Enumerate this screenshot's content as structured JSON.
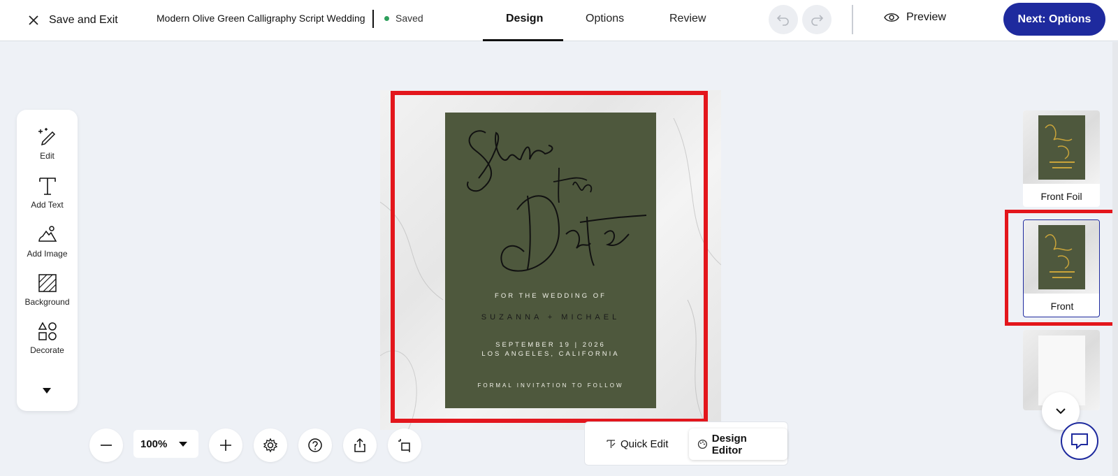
{
  "header": {
    "exit_label": "Save and Exit",
    "doc_title": "Modern Olive Green Calligraphy Script Wedding",
    "save_status": "Saved",
    "tabs": [
      {
        "label": "Design",
        "active": true
      },
      {
        "label": "Options",
        "active": false
      },
      {
        "label": "Review",
        "active": false
      }
    ],
    "preview_label": "Preview",
    "next_label": "Next: Options"
  },
  "tools": [
    {
      "label": "Edit",
      "icon": "magic-pencil-icon"
    },
    {
      "label": "Add Text",
      "icon": "text-icon"
    },
    {
      "label": "Add Image",
      "icon": "image-icon"
    },
    {
      "label": "Background",
      "icon": "background-icon"
    },
    {
      "label": "Decorate",
      "icon": "shapes-icon"
    }
  ],
  "card": {
    "script": "Save the Date",
    "line1": "FOR THE WEDDING OF",
    "names": "SUZANNA + MICHAEL",
    "date": "SEPTEMBER 19 | 2026",
    "location": "LOS ANGELES, CALIFORNIA",
    "footer": "FORMAL INVITATION TO FOLLOW"
  },
  "thumbnails": [
    {
      "label": "Front Foil",
      "selected": false
    },
    {
      "label": "Front",
      "selected": true
    }
  ],
  "zoom": {
    "value": "100%"
  },
  "modes": {
    "quick_edit": "Quick Edit",
    "design_editor": "Design Editor"
  },
  "colors": {
    "accent": "#1e2a9e",
    "card_green": "#4e583d",
    "highlight_red": "#e3161c",
    "saved_dot": "#2e9f5c"
  }
}
